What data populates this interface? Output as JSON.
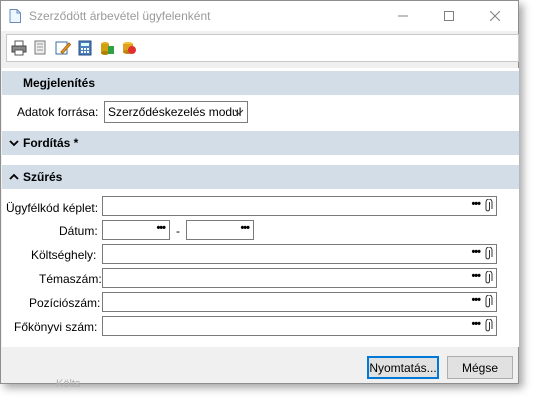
{
  "window": {
    "title": "Szerződött árbevétel ügyfelenként"
  },
  "toolbar": {
    "buttons": [
      "print-icon",
      "print-preview-icon",
      "edit-layout-icon",
      "calculator-icon",
      "export-icon",
      "refresh-icon"
    ]
  },
  "sections": {
    "display": {
      "title": "Megjelenítés",
      "source_label": "Adatok forrása:",
      "source_value": "Szerződéskezelés modul"
    },
    "translation": {
      "title": "Fordítás *"
    },
    "filter": {
      "title": "Szűrés",
      "fields": {
        "customer_code": "Ügyfélkód képlet:",
        "date": "Dátum:",
        "date_separator": "-",
        "cost_center": "Költséghely:",
        "topic": "Témaszám:",
        "position": "Pozíciószám:",
        "ledger": "Főkönyvi szám:"
      }
    }
  },
  "footer": {
    "print_label": "Nyomtatás...",
    "cancel_label": "Mégse"
  },
  "behind_text": "Költs"
}
